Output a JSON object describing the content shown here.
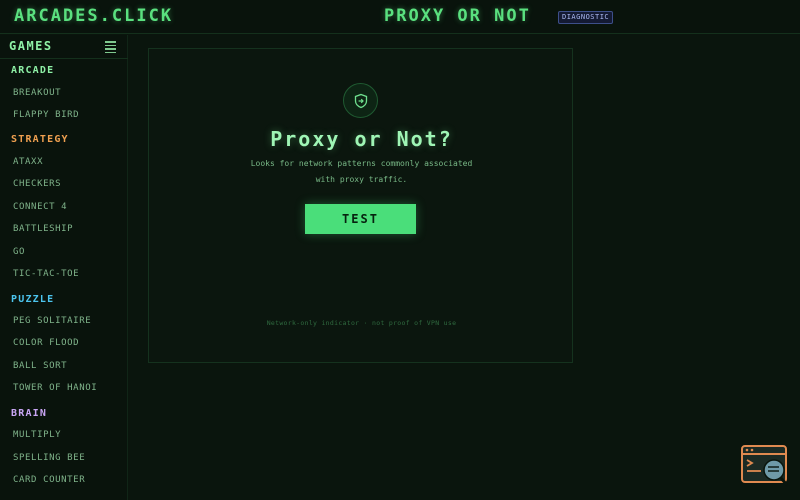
{
  "header": {
    "site_title": "ARCADES.CLICK",
    "page_heading": "PROXY OR NOT",
    "badge": "DIAGNOSTIC"
  },
  "sidebar": {
    "title": "GAMES",
    "menu_icon": "hamburger-menu-icon",
    "categories": [
      {
        "label": "ARCADE",
        "color": "#8ef0a6",
        "items": [
          "BREAKOUT",
          "FLAPPY BIRD"
        ]
      },
      {
        "label": "STRATEGY",
        "color": "#f0a050",
        "items": [
          "ATAXX",
          "CHECKERS",
          "CONNECT 4",
          "BATTLESHIP",
          "GO",
          "TIC-TAC-TOE"
        ]
      },
      {
        "label": "PUZZLE",
        "color": "#4cc4ee",
        "items": [
          "PEG SOLITAIRE",
          "COLOR FLOOD",
          "BALL SORT",
          "TOWER OF HANOI"
        ]
      },
      {
        "label": "BRAIN",
        "color": "#c9a6f5",
        "items": [
          "MULTIPLY",
          "SPELLING BEE",
          "CARD COUNTER"
        ]
      }
    ]
  },
  "main": {
    "icon": "shield-check-icon",
    "title": "Proxy or Not?",
    "description": "Looks for network patterns commonly associated with proxy traffic.",
    "button_label": "TEST",
    "footnote": "Network-only indicator · not proof of VPN use"
  },
  "widget": {
    "icon": "browser-search-icon"
  },
  "colors": {
    "accent": "#4ade7a",
    "background": "#0a150d",
    "badge": "#aab8f0"
  }
}
